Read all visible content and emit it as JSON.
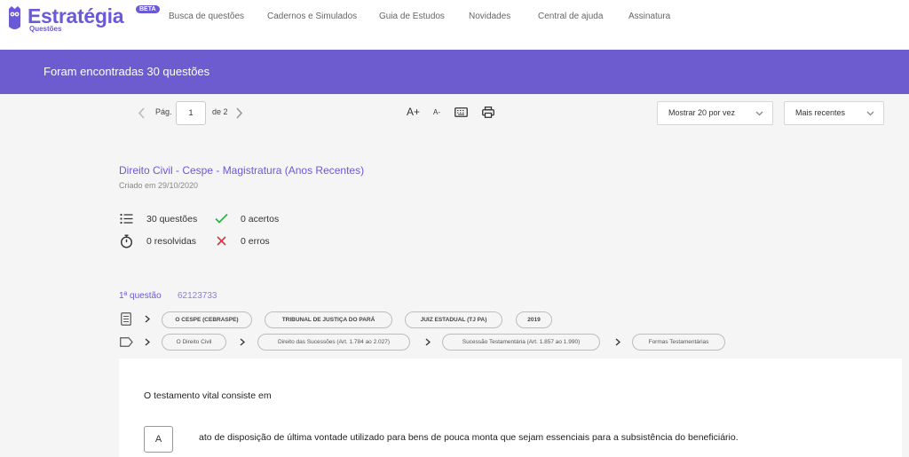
{
  "header": {
    "brand": "Estratégia",
    "brand_sub": "Questões",
    "beta": "BETA",
    "nav": [
      {
        "label": "Busca de questões"
      },
      {
        "label": "Cadernos e Simulados"
      },
      {
        "label": "Guia de Estudos"
      },
      {
        "label": "Novidades"
      },
      {
        "label": "Central de ajuda"
      },
      {
        "label": "Assinatura"
      }
    ]
  },
  "banner": {
    "text": "Foram encontradas 30 questões"
  },
  "pager": {
    "pag_label": "Pág.",
    "page_value": "1",
    "of_label": "de 2"
  },
  "tools": {
    "font_increase": "A+",
    "font_decrease": "A-"
  },
  "filters": {
    "per_page": "Mostrar 20 por vez",
    "sort": "Mais recentes"
  },
  "notebook": {
    "title": "Direito Civil - Cespe - Magistratura (Anos Recentes)",
    "created": "Criado em 29/10/2020",
    "stats": {
      "questions": "30 questões",
      "correct": "0 acertos",
      "solved": "0 resolvidas",
      "errors": "0 erros"
    }
  },
  "question": {
    "number": "1ª questão",
    "id": "62123733",
    "info_tags": [
      "O CESPE (CEBRASPE)",
      "TRIBUNAL DE JUSTIÇA DO PARÁ",
      "JUIZ ESTADUAL (TJ PA)",
      "2019"
    ],
    "subject_path": [
      "O Direito Civil",
      "Direito das Sucessões (Art. 1.784 ao 2.027)",
      "Sucessão Testamentária (Art. 1.857 ao 1.990)",
      "Formas Testamentárias"
    ],
    "statement": "O testamento vital consiste em",
    "alternatives": [
      {
        "letter": "A",
        "text": "ato de disposição de última vontade utilizado para bens de pouca monta que sejam essenciais para a subsistência do beneficiário."
      }
    ]
  },
  "colors": {
    "accent": "#6c5ccf",
    "brand": "#6a5ad8",
    "success": "#2db44a",
    "danger": "#d9363e"
  }
}
